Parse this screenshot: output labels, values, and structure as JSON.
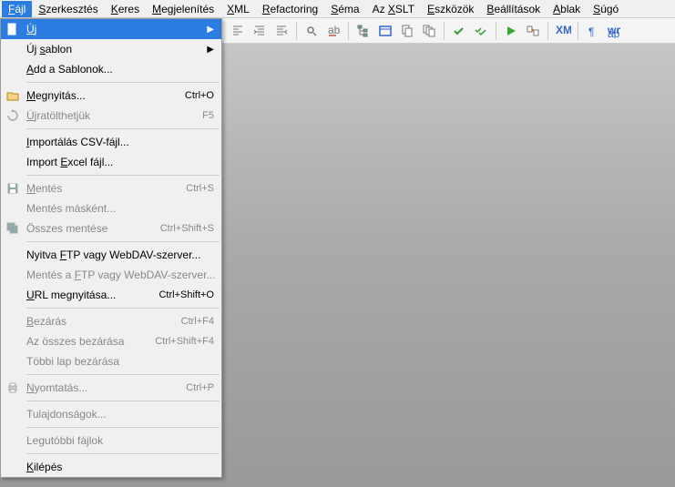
{
  "menubar": {
    "items": [
      {
        "label": "Fájl",
        "u": 0,
        "active": true
      },
      {
        "label": "Szerkesztés",
        "u": 0
      },
      {
        "label": "Keres",
        "u": 0
      },
      {
        "label": "Megjelenítés",
        "u": 0
      },
      {
        "label": "XML",
        "u": 0
      },
      {
        "label": "Refactoring",
        "u": 0
      },
      {
        "label": "Séma",
        "u": 0
      },
      {
        "label": "Az XSLT",
        "u": 3
      },
      {
        "label": "Eszközök",
        "u": 0
      },
      {
        "label": "Beállítások",
        "u": 0
      },
      {
        "label": "Ablak",
        "u": 0
      },
      {
        "label": "Súgó",
        "u": 0
      }
    ]
  },
  "dropdown": {
    "groups": [
      [
        {
          "label": "Új",
          "u": 0,
          "icon": "new-file",
          "highlighted": true,
          "arrow": true
        },
        {
          "label": "Új sablon",
          "u": 3,
          "arrow": true
        },
        {
          "label": "Add a Sablonok...",
          "u": 0
        }
      ],
      [
        {
          "label": "Megnyitás...",
          "u": 0,
          "icon": "open-folder",
          "shortcut": "Ctrl+O"
        },
        {
          "label": "Újratölthetjük",
          "u": 0,
          "icon": "reload",
          "shortcut": "F5",
          "disabled": true
        }
      ],
      [
        {
          "label": "Importálás CSV-fájl...",
          "u": 0
        },
        {
          "label": "Import Excel fájl...",
          "u": 7
        }
      ],
      [
        {
          "label": "Mentés",
          "u": 0,
          "icon": "save",
          "shortcut": "Ctrl+S",
          "disabled": true
        },
        {
          "label": "Mentés másként...",
          "disabled": true
        },
        {
          "label": "Összes mentése",
          "icon": "save-all",
          "shortcut": "Ctrl+Shift+S",
          "disabled": true
        }
      ],
      [
        {
          "label": "Nyitva FTP vagy WebDAV-szerver...",
          "u": 7
        },
        {
          "label": "Mentés a FTP vagy WebDAV-szerver...",
          "u": 9,
          "disabled": true
        },
        {
          "label": "URL megnyitása...",
          "u": 0,
          "shortcut": "Ctrl+Shift+O"
        }
      ],
      [
        {
          "label": "Bezárás",
          "u": 0,
          "shortcut": "Ctrl+F4",
          "disabled": true
        },
        {
          "label": "Az összes bezárása",
          "shortcut": "Ctrl+Shift+F4",
          "disabled": true
        },
        {
          "label": "Többi lap bezárása",
          "disabled": true
        }
      ],
      [
        {
          "label": "Nyomtatás...",
          "u": 0,
          "icon": "print",
          "shortcut": "Ctrl+P",
          "disabled": true
        }
      ],
      [
        {
          "label": "Tulajdonságok...",
          "disabled": true
        }
      ],
      [
        {
          "label": "Legutóbbi fájlok",
          "disabled": true
        }
      ],
      [
        {
          "label": "Kilépés",
          "u": 0
        }
      ]
    ]
  },
  "toolbar_icons": [
    "indent-left",
    "indent-right",
    "outdent",
    "sep",
    "find",
    "replace",
    "sep",
    "tree",
    "window",
    "copy-doc",
    "multi-doc",
    "sep",
    "check",
    "double-check",
    "sep",
    "play",
    "transform",
    "sep",
    "xml",
    "sep",
    "pilcrow",
    "wrap"
  ]
}
